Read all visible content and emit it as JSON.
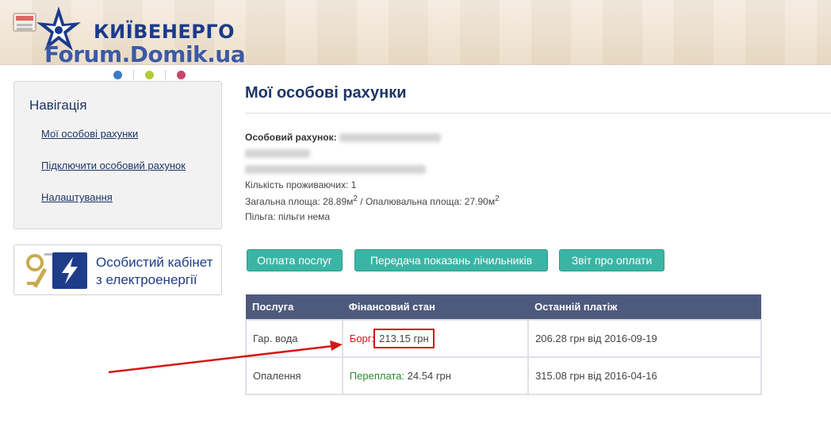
{
  "header": {
    "brand_name": "КИЇВЕНЕРГО",
    "watermark": "Forum.Domik.ua"
  },
  "dots": {
    "colors": [
      "#3b7bc4",
      "#b3cb3a",
      "#c9466a"
    ]
  },
  "nav": {
    "title": "Навігація",
    "links": [
      "Мої особові рахунки",
      "Підключити особовий рахунок",
      "Налаштування"
    ]
  },
  "cabinet": {
    "line1": "Особистий кабінет",
    "line2": "з електроенергії"
  },
  "main": {
    "title": "Мої особові рахунки",
    "account_label": "Особовий рахунок:",
    "residents": "Кількість проживаючих: 1",
    "area_total": "Загальна площа: 28.89м",
    "area_heated": " / Опалювальна площа: 27.90м",
    "area_unit_sup": "2",
    "benefit": "Пільга: пільги нема"
  },
  "buttons": [
    "Оплата послуг",
    "Передача показань лічильників",
    "Звіт про оплати"
  ],
  "table": {
    "headers": [
      "Послуга",
      "Фінансовий стан",
      "Останній платіж"
    ],
    "rows": [
      {
        "service": "Гар. вода",
        "status_label": "Борг:",
        "status_value": "213.15 грн",
        "last_payment": "206.28 грн від 2016-09-19"
      },
      {
        "service": "Опалення",
        "status_label": "Переплата:",
        "status_value": "24.54 грн",
        "last_payment": "315.08 грн від 2016-04-16"
      }
    ]
  },
  "colors": {
    "accent_button": "#3ab5a5",
    "table_header": "#4d5a7e",
    "debt": "#d41616",
    "overpay": "#2d8a2d",
    "annotation": "#d41616"
  }
}
